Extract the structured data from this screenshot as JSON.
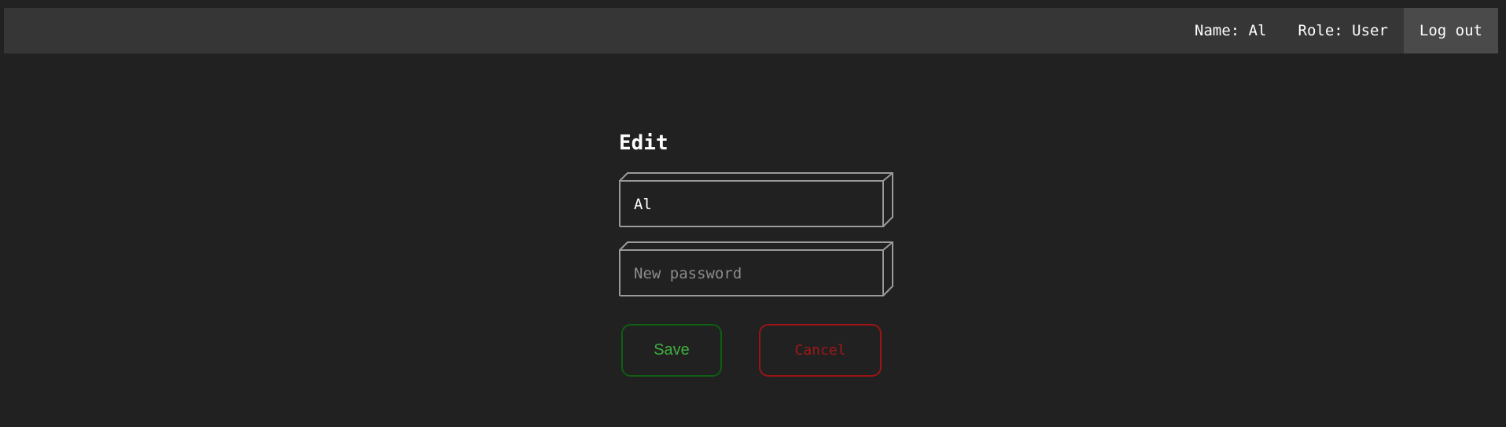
{
  "header": {
    "name_label": "Name: Al",
    "role_label": "Role: User",
    "logout_label": "Log out"
  },
  "form": {
    "title": "Edit",
    "username": {
      "value": "Al",
      "placeholder": ""
    },
    "password": {
      "value": "",
      "placeholder": "New password"
    },
    "save_label": "Save",
    "cancel_label": "Cancel"
  },
  "colors": {
    "background": "#212121",
    "topbar": "#363636",
    "logout_bg": "#4a4a4a",
    "save_border": "#0f5e12",
    "save_text": "#3fae3f",
    "cancel_border": "#9a1515",
    "cancel_text": "#a31717"
  }
}
